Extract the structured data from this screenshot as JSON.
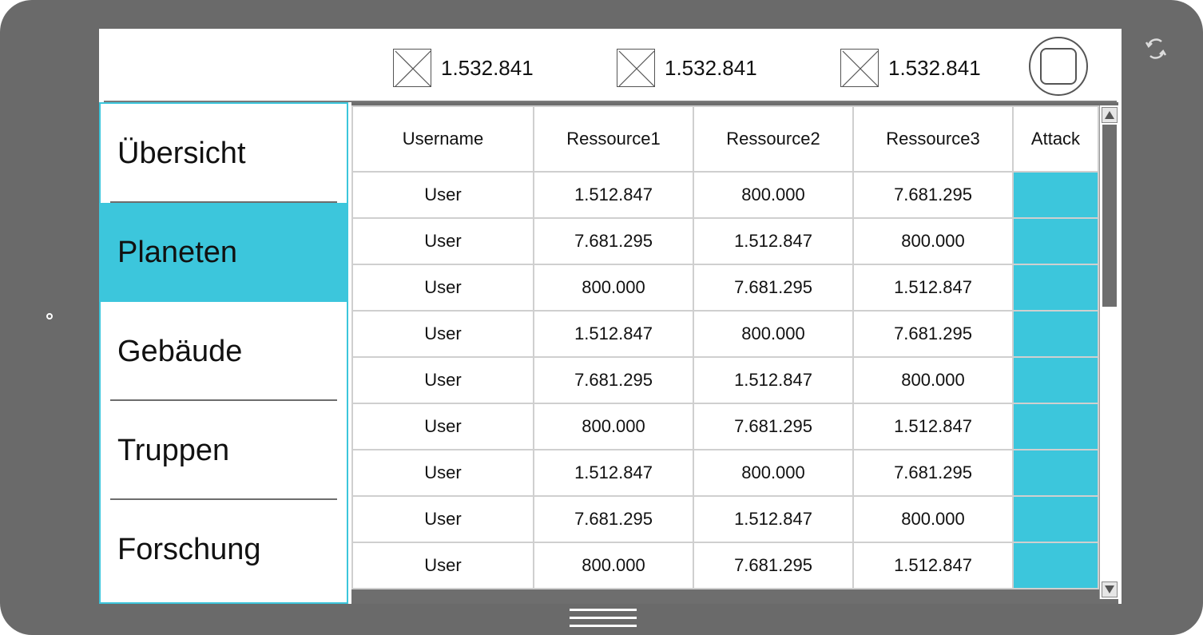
{
  "header": {
    "resources": [
      {
        "icon": "image-placeholder-icon",
        "value": "1.532.841"
      },
      {
        "icon": "image-placeholder-icon",
        "value": "1.532.841"
      },
      {
        "icon": "image-placeholder-icon",
        "value": "1.532.841"
      }
    ],
    "profile_icon": "profile-button-icon"
  },
  "sidebar": {
    "items": [
      {
        "label": "Übersicht",
        "active": false
      },
      {
        "label": "Planeten",
        "active": true
      },
      {
        "label": "Gebäude",
        "active": false
      },
      {
        "label": "Truppen",
        "active": false
      },
      {
        "label": "Forschung",
        "active": false
      }
    ]
  },
  "table": {
    "columns": [
      "Username",
      "Ressource1",
      "Ressource2",
      "Ressource3",
      "Attack"
    ],
    "rows": [
      [
        "User",
        "1.512.847",
        "800.000",
        "7.681.295"
      ],
      [
        "User",
        "7.681.295",
        "1.512.847",
        "800.000"
      ],
      [
        "User",
        "800.000",
        "7.681.295",
        "1.512.847"
      ],
      [
        "User",
        "1.512.847",
        "800.000",
        "7.681.295"
      ],
      [
        "User",
        "7.681.295",
        "1.512.847",
        "800.000"
      ],
      [
        "User",
        "800.000",
        "7.681.295",
        "1.512.847"
      ],
      [
        "User",
        "1.512.847",
        "800.000",
        "7.681.295"
      ],
      [
        "User",
        "7.681.295",
        "1.512.847",
        "800.000"
      ],
      [
        "User",
        "800.000",
        "7.681.295",
        "1.512.847"
      ]
    ]
  },
  "colors": {
    "accent": "#3cc6dc",
    "frame": "#6a6a6a"
  }
}
